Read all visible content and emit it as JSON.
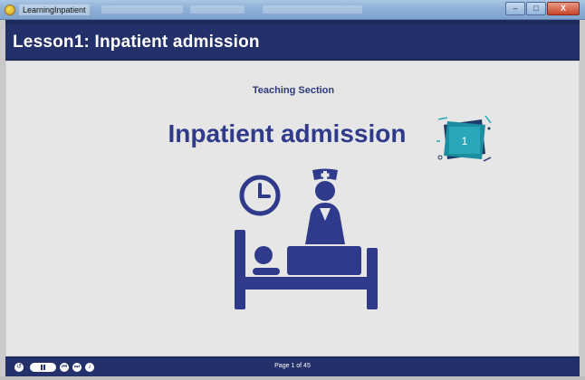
{
  "window": {
    "title": "LearningInpatient",
    "controls": {
      "minimize": "–",
      "maximize": "□",
      "close": "X"
    }
  },
  "header": {
    "title": "Lesson1: Inpatient admission"
  },
  "slide": {
    "section": "Teaching Section",
    "heading": "Inpatient admission",
    "badge_number": "1",
    "illustration": "nurse-clock-patient-bed-icon"
  },
  "player": {
    "page_label": "Page 1 of 45",
    "controls": [
      "replay-icon",
      "pause-icon",
      "previous-icon",
      "next-icon",
      "volume-icon"
    ]
  },
  "colors": {
    "navy": "#24306a",
    "heading_blue": "#2f3b8a",
    "slide_bg": "#e6e6e6",
    "badge_teal": "#1b8fa0"
  }
}
